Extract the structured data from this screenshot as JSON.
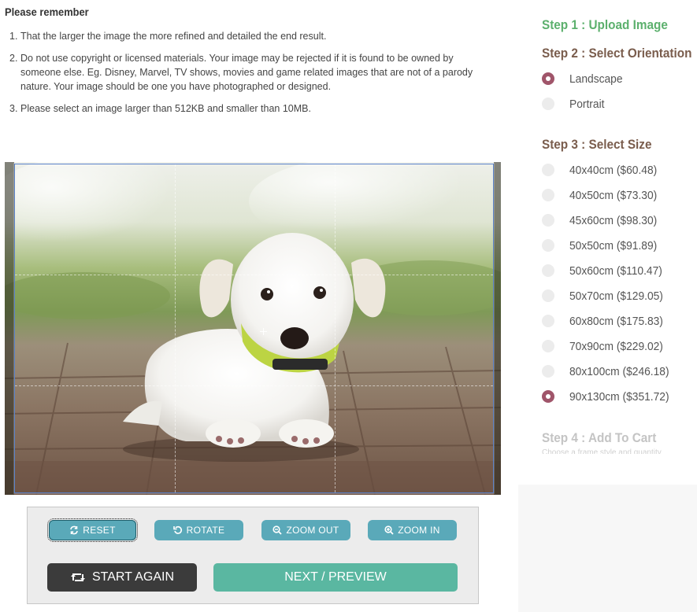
{
  "remember": {
    "title": "Please remember",
    "items": [
      {
        "num": "1.",
        "text": "That the larger the image the more refined and detailed the end result."
      },
      {
        "num": "2.",
        "text": "Do not use copyright or licensed materials. Your image may be rejected if it is found to be owned by someone else. Eg. Disney, Marvel, TV shows, movies and game related images that are not of a parody nature. Your image should be one you have photographed or designed."
      },
      {
        "num": "3.",
        "text": "Please select an image larger than 512KB and smaller than 10MB."
      }
    ]
  },
  "toolbar": {
    "reset": "RESET",
    "rotate": "ROTATE",
    "zoom_out": "ZOOM OUT",
    "zoom_in": "ZOOM IN",
    "start_again": "START AGAIN",
    "next_preview": "NEXT / PREVIEW"
  },
  "steps": {
    "step1": "Step 1 : Upload Image",
    "step2": "Step 2 : Select Orientation",
    "step3": "Step 3 : Select Size",
    "step4": "Step 4 : Add To Cart",
    "step4_fragment": "Choose a frame style and quantity"
  },
  "orientation": {
    "options": [
      "Landscape",
      "Portrait"
    ],
    "selected": "Landscape"
  },
  "sizes": {
    "options": [
      "40x40cm ($60.48)",
      "40x50cm ($73.30)",
      "45x60cm ($98.30)",
      "50x50cm ($91.89)",
      "50x60cm ($110.47)",
      "50x70cm ($129.05)",
      "60x80cm ($175.83)",
      "70x90cm ($229.02)",
      "80x100cm ($246.18)",
      "90x130cm ($351.72)"
    ],
    "selected": "90x130cm ($351.72)"
  },
  "colors": {
    "step_done": "#5cb06d",
    "step_active": "#7a5d4d",
    "radio_checked": "#a0556a",
    "tool_button": "#5aa9b9",
    "next_button": "#5ab7a1",
    "start_button": "#3b3b3b"
  },
  "icons": {
    "reset": "refresh-icon",
    "rotate": "rotate-icon",
    "zoom_out": "zoom-out-icon",
    "zoom_in": "zoom-in-icon",
    "start_again": "retweet-icon"
  }
}
